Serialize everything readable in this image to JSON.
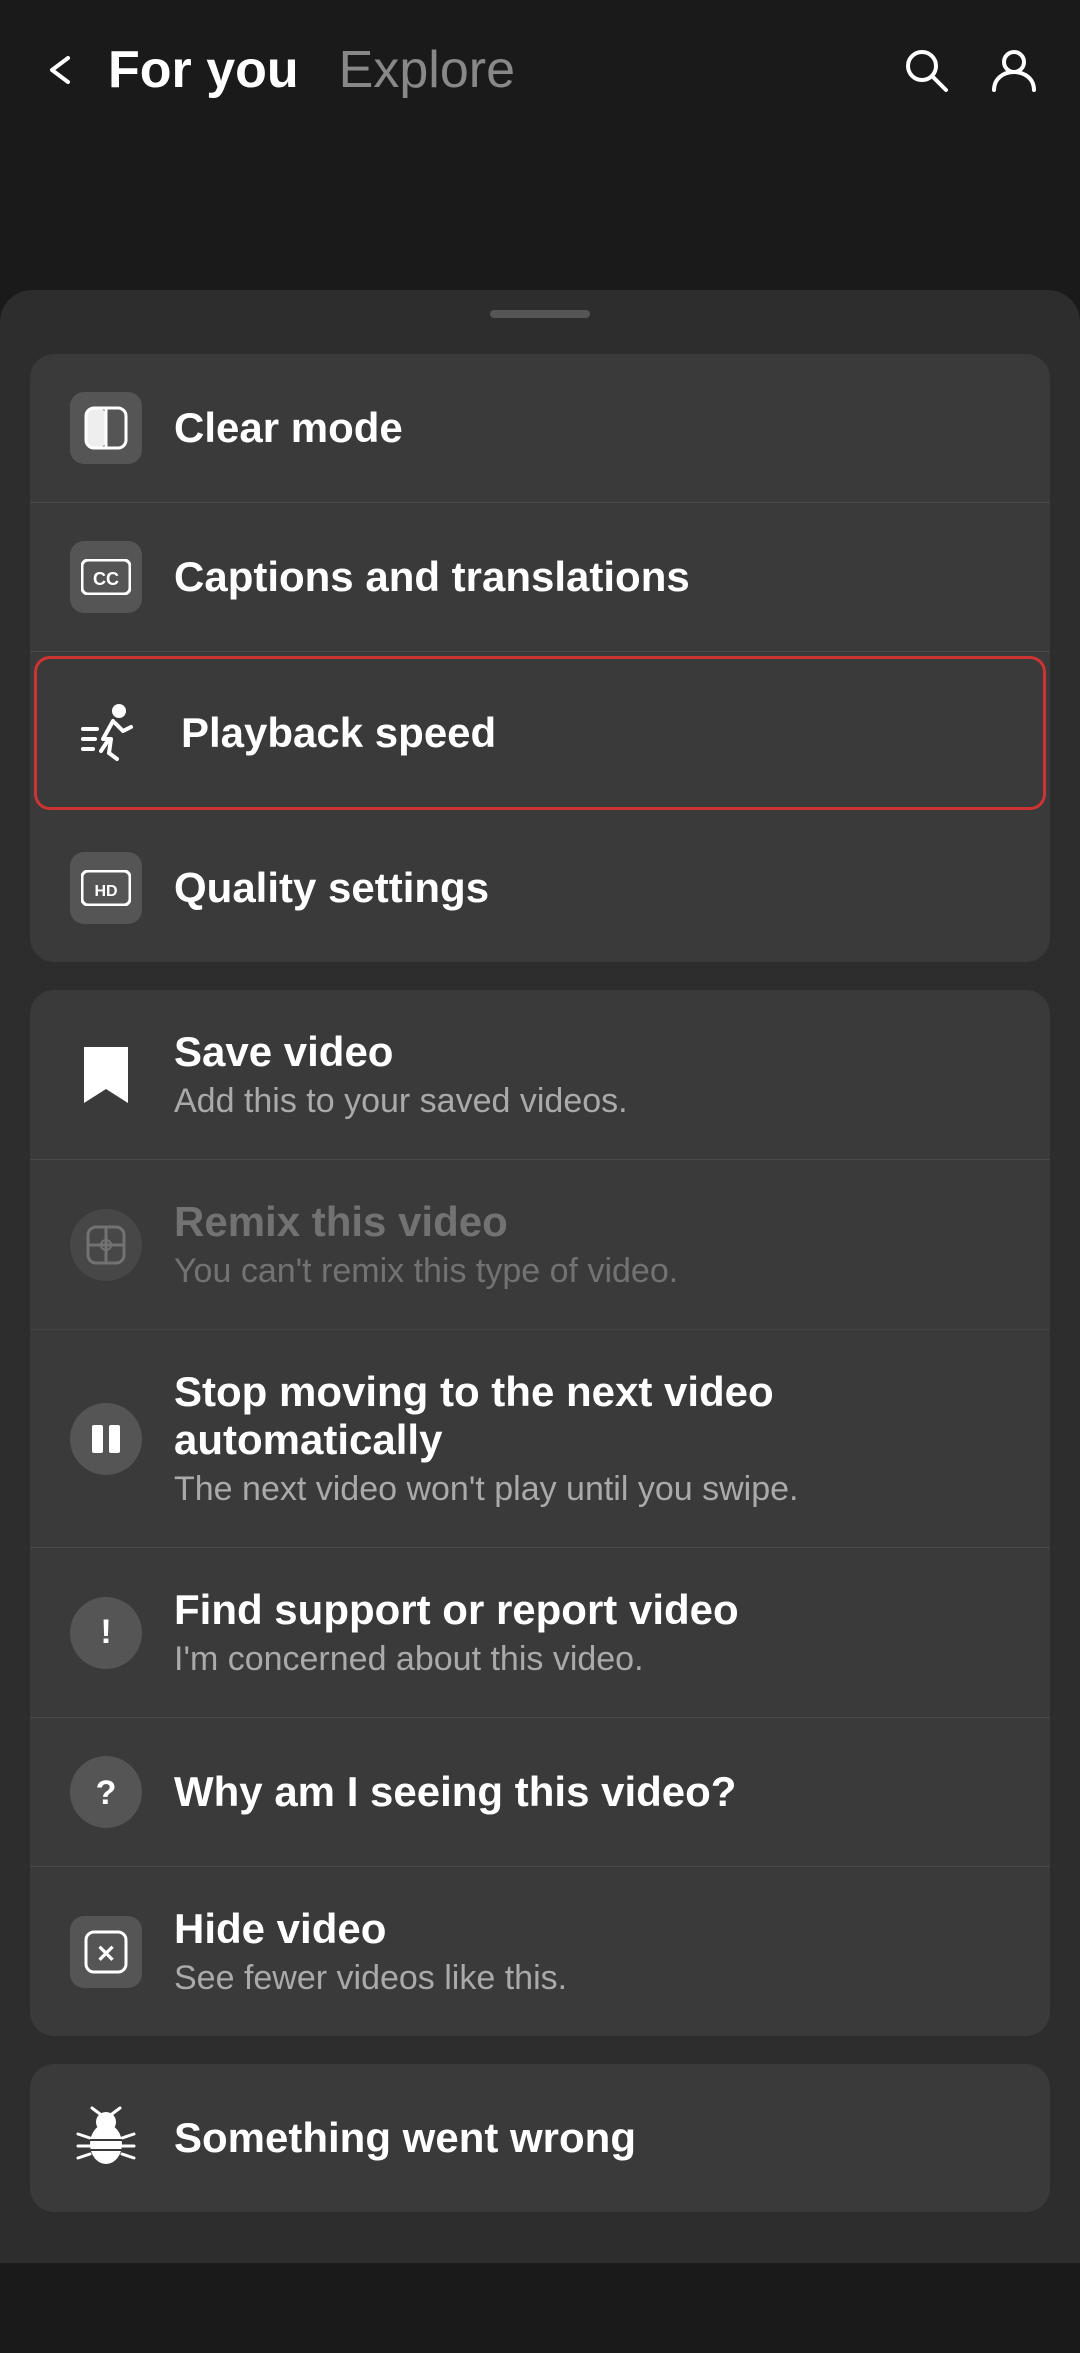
{
  "header": {
    "back_label": "‹",
    "title_for_you": "For you",
    "title_explore": "Explore"
  },
  "menu_group_1": {
    "items": [
      {
        "id": "clear-mode",
        "label": "Clear mode",
        "subtitle": "",
        "icon": "half-circle-icon",
        "highlighted": false,
        "dimmed": false
      },
      {
        "id": "captions",
        "label": "Captions and translations",
        "subtitle": "",
        "icon": "cc-icon",
        "highlighted": false,
        "dimmed": false
      },
      {
        "id": "playback-speed",
        "label": "Playback speed",
        "subtitle": "",
        "icon": "running-icon",
        "highlighted": true,
        "dimmed": false
      },
      {
        "id": "quality-settings",
        "label": "Quality settings",
        "subtitle": "",
        "icon": "hd-icon",
        "highlighted": false,
        "dimmed": false
      }
    ]
  },
  "menu_group_2": {
    "items": [
      {
        "id": "save-video",
        "label": "Save video",
        "subtitle": "Add this to your saved videos.",
        "icon": "bookmark-icon",
        "highlighted": false,
        "dimmed": false
      },
      {
        "id": "remix-video",
        "label": "Remix this video",
        "subtitle": "You can't remix this type of video.",
        "icon": "remix-icon",
        "highlighted": false,
        "dimmed": true
      },
      {
        "id": "stop-autoplay",
        "label": "Stop moving to the next video automatically",
        "subtitle": "The next video won't play until you swipe.",
        "icon": "pause-icon",
        "highlighted": false,
        "dimmed": false
      },
      {
        "id": "find-support",
        "label": "Find support or report video",
        "subtitle": "I'm concerned about this video.",
        "icon": "exclamation-icon",
        "highlighted": false,
        "dimmed": false
      },
      {
        "id": "why-seeing",
        "label": "Why am I seeing this video?",
        "subtitle": "",
        "icon": "question-icon",
        "highlighted": false,
        "dimmed": false
      },
      {
        "id": "hide-video",
        "label": "Hide video",
        "subtitle": "See fewer videos like this.",
        "icon": "hide-icon",
        "highlighted": false,
        "dimmed": false
      }
    ]
  },
  "error_bar": {
    "label": "Something went wrong",
    "icon": "bug-icon"
  }
}
